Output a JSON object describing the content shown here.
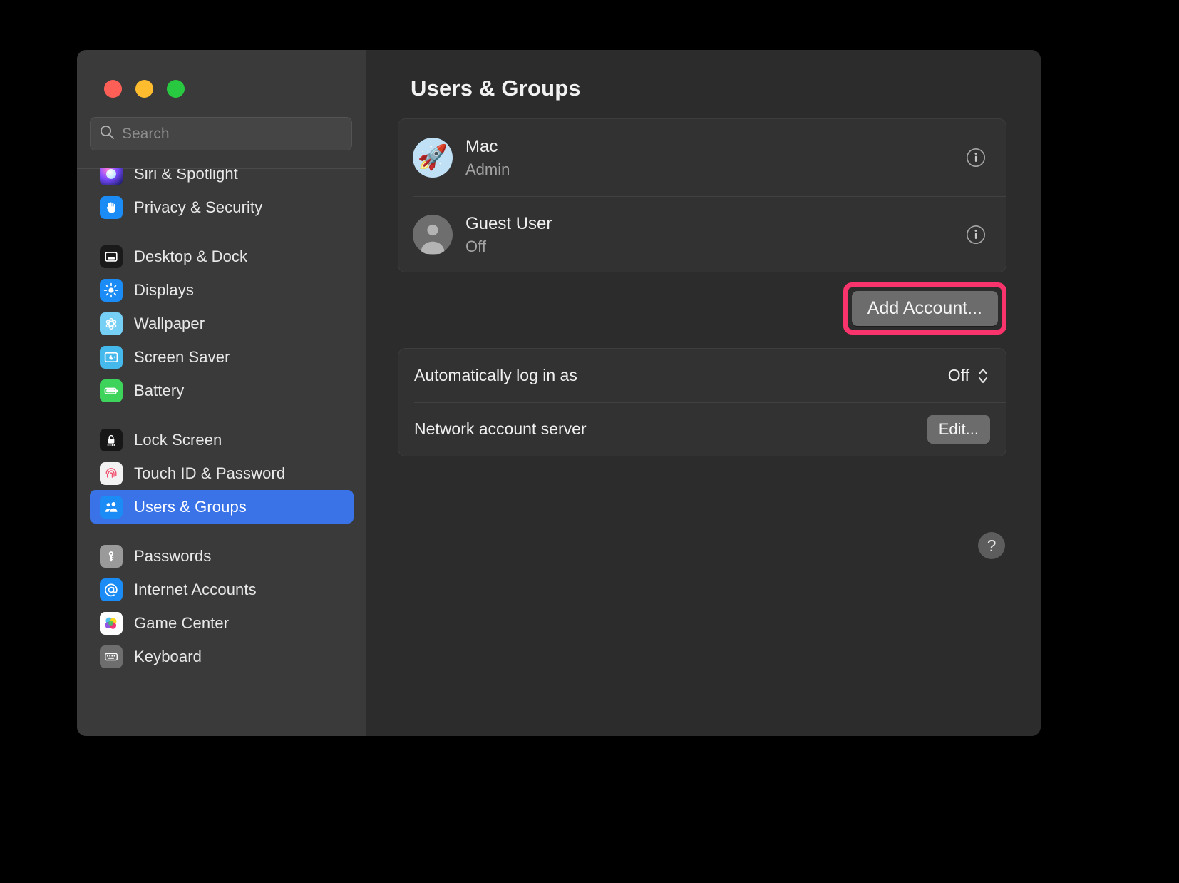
{
  "window": {
    "traffic_lights": [
      {
        "name": "close",
        "color": "#ff5f56"
      },
      {
        "name": "minimize",
        "color": "#febc2e"
      },
      {
        "name": "zoom",
        "color": "#28c840"
      }
    ]
  },
  "search": {
    "placeholder": "Search",
    "value": "",
    "icon": "search-icon"
  },
  "sidebar": {
    "items": [
      {
        "label": "Siri & Spotlight",
        "icon": "siri-icon",
        "selected": false,
        "clipped_top": true
      },
      {
        "label": "Privacy & Security",
        "icon": "hand-icon",
        "selected": false
      },
      {
        "gap": true
      },
      {
        "label": "Desktop & Dock",
        "icon": "desktop-dock-icon",
        "selected": false
      },
      {
        "label": "Displays",
        "icon": "displays-icon",
        "selected": false
      },
      {
        "label": "Wallpaper",
        "icon": "wallpaper-icon",
        "selected": false
      },
      {
        "label": "Screen Saver",
        "icon": "screen-saver-icon",
        "selected": false
      },
      {
        "label": "Battery",
        "icon": "battery-icon",
        "selected": false
      },
      {
        "gap": true
      },
      {
        "label": "Lock Screen",
        "icon": "lock-icon",
        "selected": false
      },
      {
        "label": "Touch ID & Password",
        "icon": "fingerprint-icon",
        "selected": false
      },
      {
        "label": "Users & Groups",
        "icon": "users-groups-icon",
        "selected": true
      },
      {
        "gap": true
      },
      {
        "label": "Passwords",
        "icon": "key-icon",
        "selected": false
      },
      {
        "label": "Internet Accounts",
        "icon": "at-sign-icon",
        "selected": false
      },
      {
        "label": "Game Center",
        "icon": "game-center-icon",
        "selected": false
      },
      {
        "label": "Keyboard",
        "icon": "keyboard-icon",
        "selected": false,
        "clipped_bottom": true
      }
    ]
  },
  "main": {
    "title": "Users & Groups",
    "users": [
      {
        "name": "Mac",
        "role": "Admin",
        "avatar": "rocket-avatar",
        "info_label": "i"
      },
      {
        "name": "Guest User",
        "role": "Off",
        "avatar": "person-avatar",
        "info_label": "i"
      }
    ],
    "add_account_label": "Add Account...",
    "login_rows": [
      {
        "label": "Automatically log in as",
        "value": "Off",
        "control": "popup-stepper"
      },
      {
        "label": "Network account server",
        "value": "Edit...",
        "control": "button"
      }
    ],
    "help_label": "?"
  },
  "colors": {
    "accent": "#3a73e8",
    "highlight": "#f9336b",
    "window_bg": "#2c2c2c",
    "sidebar_bg": "#3a3a3a",
    "card_bg": "#323232"
  }
}
